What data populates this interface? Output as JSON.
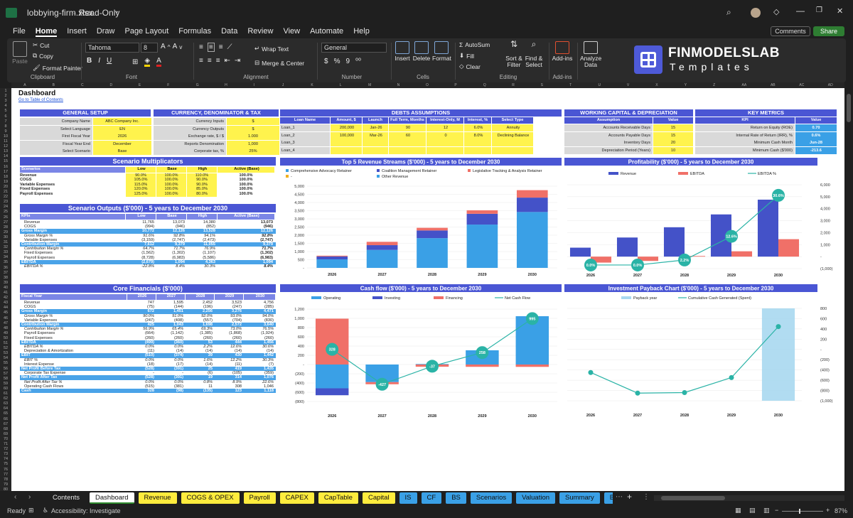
{
  "titlebar": {
    "filename": "lobbying-firm.xlsx",
    "mode": "Read-Only"
  },
  "menu": {
    "items": [
      "File",
      "Home",
      "Insert",
      "Draw",
      "Page Layout",
      "Formulas",
      "Data",
      "Review",
      "View",
      "Automate",
      "Help"
    ],
    "active": "Home",
    "comments": "Comments",
    "share": "Share"
  },
  "ribbon": {
    "clipboard": {
      "paste": "Paste",
      "cut": "Cut",
      "copy": "Copy",
      "painter": "Format Painter",
      "group": "Clipboard"
    },
    "font": {
      "name": "Tahoma",
      "size": "8",
      "group": "Font"
    },
    "alignment": {
      "wrap": "Wrap Text",
      "merge": "Merge & Center",
      "group": "Alignment"
    },
    "number": {
      "format": "General",
      "group": "Number"
    },
    "cells": {
      "insert": "Insert",
      "delete": "Delete",
      "format": "Format",
      "group": "Cells"
    },
    "editing": {
      "autosum": "AutoSum",
      "fill": "Fill",
      "clear": "Clear",
      "sort": "Sort &",
      "sort2": "Filter",
      "find": "Find &",
      "find2": "Select",
      "group": "Editing"
    },
    "addins": {
      "label": "Add-ins",
      "group": "Add-ins"
    },
    "analyze": {
      "label": "Analyze",
      "label2": "Data"
    },
    "brand": {
      "line1": "FINMODELSLAB",
      "line2": "Templates"
    }
  },
  "columns": [
    "A",
    "B",
    "C",
    "D",
    "E",
    "F",
    "G",
    "H",
    "I",
    "J",
    "K",
    "L",
    "M",
    "N",
    "O",
    "P",
    "Q",
    "R",
    "S",
    "T",
    "U",
    "V",
    "X",
    "Y",
    "Z",
    "AA",
    "AB",
    "AC",
    "AD"
  ],
  "sheet": {
    "title": "Dashboard",
    "toc": "Go to Table of Contents",
    "general": {
      "title": "GENERAL SETUP",
      "rows": [
        [
          "Company Name",
          "ABC Company Inc."
        ],
        [
          "Select Language",
          "EN"
        ],
        [
          "First Fiscal Year",
          "2026"
        ],
        [
          "Fiscal Year End",
          "December"
        ],
        [
          "Select Scenario",
          "Base"
        ]
      ]
    },
    "currency": {
      "title": "CURRENCY, DENOMINATOR & TAX",
      "rows": [
        [
          "Currency Inputs",
          "$"
        ],
        [
          "Currency Outputs",
          "$"
        ],
        [
          "Exchange rate, $ / $",
          "1.000"
        ],
        [
          "Reports Denomination",
          "1,000"
        ],
        [
          "Corporate tax, %",
          "25%"
        ]
      ]
    },
    "debts": {
      "title": "DEBTS ASSUMPTIONS",
      "headers": [
        "Loan Name",
        "Amount, $",
        "Launch",
        "Full Term, Months",
        "Interest-Only, M",
        "Interest, %",
        "Select Type"
      ],
      "rows": [
        [
          "Loan_1",
          "200,000",
          "Jan-26",
          "90",
          "12",
          "6.0%",
          "Annuity"
        ],
        [
          "Loan_2",
          "100,000",
          "Mar-26",
          "60",
          "0",
          "8.0%",
          "Declining Balance"
        ],
        [
          "Loan_3",
          "",
          "",
          "",
          "",
          "",
          ""
        ],
        [
          "Loan_4",
          "",
          "",
          "",
          "",
          "",
          ""
        ]
      ]
    },
    "wc": {
      "title": "WORKING CAPITAL & DEPRECIATION",
      "headers": [
        "Assumption",
        "Value"
      ],
      "rows": [
        [
          "Accounts Receivable Days",
          "15"
        ],
        [
          "Accounts Payable Days",
          "15"
        ],
        [
          "Inventory Days",
          "20"
        ],
        [
          "Depreciation Period (Years)",
          "10"
        ]
      ]
    },
    "kpi": {
      "title": "KEY METRICS",
      "headers": [
        "KPI",
        "Value"
      ],
      "rows": [
        [
          "Return on Equity (ROE)",
          "0.70"
        ],
        [
          "Internal Rate of Return (IRR), %",
          "0.6%"
        ],
        [
          "Minimum Cash Month",
          "Jun-28"
        ],
        [
          "Minimum Cash ($'000)",
          "-213.6"
        ]
      ]
    },
    "scen": {
      "title": "Scenario Multiplicators",
      "headers": [
        "Scenarios",
        "Low",
        "Base",
        "High",
        "Active (Base)"
      ],
      "rows": [
        [
          "Revenue",
          "90.0%",
          "100.0%",
          "110.0%",
          "100.0%"
        ],
        [
          "COGS",
          "105.0%",
          "100.0%",
          "90.0%",
          "100.0%"
        ],
        [
          "Variable Expenses",
          "115.0%",
          "100.0%",
          "90.0%",
          "100.0%"
        ],
        [
          "Fixed Expenses",
          "120.0%",
          "100.0%",
          "85.0%",
          "100.0%"
        ],
        [
          "Payroll Expenses",
          "125.0%",
          "100.0%",
          "80.0%",
          "100.0%"
        ]
      ]
    },
    "outputs": {
      "title": "Scenario Outputs ($'000) - 5 years to December 2030",
      "headers": [
        "KPIs",
        "Low",
        "Base",
        "High",
        "Active (Base)"
      ],
      "rows": [
        [
          "Revenue",
          "11,765",
          "13,073",
          "14,380",
          "13,073",
          "n"
        ],
        [
          "COGS",
          "(994)",
          "(946)",
          "(852)",
          "(946)",
          "n"
        ],
        [
          "Gross Margin",
          "10,772",
          "12,126",
          "13,528",
          "12,126",
          "h"
        ],
        [
          "Gross Margin %",
          "91.6%",
          "92.8%",
          "94.1%",
          "92.8%",
          "i"
        ],
        [
          "Variable Expenses",
          "(3,159)",
          "(2,747)",
          "(2,473)",
          "(2,747)",
          "n"
        ],
        [
          "Contribution Margin",
          "7,612",
          "9,379",
          "11,055",
          "9,379",
          "h"
        ],
        [
          "Contribution Margin %",
          "64.7%",
          "71.7%",
          "76.9%",
          "71.7%",
          "i"
        ],
        [
          "Fixed Expenses",
          "(1,562)",
          "(1,302)",
          "(1,107)",
          "(1,302)",
          "n"
        ],
        [
          "Payroll Expenses",
          "(8,728)",
          "(6,983)",
          "(5,586)",
          "(6,983)",
          "n"
        ],
        [
          "EBITDA",
          "(2,679)",
          "1,094",
          "4,363",
          "1,094",
          "h"
        ],
        [
          "EBITDA %",
          "-22.8%",
          "8.4%",
          "30.3%",
          "8.4%",
          "i"
        ]
      ]
    },
    "core": {
      "title": "Core Financials ($'000)",
      "headers": [
        "Fiscal Year",
        "2026",
        "2027",
        "2028",
        "2029",
        "2030"
      ],
      "rows": [
        [
          "Revenue",
          "747",
          "1,595",
          "2,452",
          "3,523",
          "4,756",
          "n"
        ],
        [
          "COGS",
          "(75)",
          "(144)",
          "(196)",
          "(247)",
          "(285)",
          "n"
        ],
        [
          "Gross Margin",
          "672",
          "1,451",
          "2,256",
          "3,276",
          "4,471",
          "h"
        ],
        [
          "Gross Margin %",
          "90.0%",
          "91.0%",
          "92.0%",
          "93.0%",
          "94.0%",
          "i"
        ],
        [
          "Variable Expenses",
          "(247)",
          "(408)",
          "(557)",
          "(704)",
          "(830)",
          "n"
        ],
        [
          "Contribution Margin",
          "425",
          "1,043",
          "1,698",
          "2,572",
          "3,640",
          "h"
        ],
        [
          "Contribution Margin %",
          "56.9%",
          "65.4%",
          "69.3%",
          "73.0%",
          "76.5%",
          "i"
        ],
        [
          "Payroll Expenses",
          "(664)",
          "(1,142)",
          "(1,385)",
          "(1,868)",
          "(1,924)",
          "n"
        ],
        [
          "Fixed Expenses",
          "(260)",
          "(260)",
          "(260)",
          "(260)",
          "(260)",
          "n"
        ],
        [
          "EBITDA",
          "(499)",
          "(360)",
          "53",
          "444",
          "1,456",
          "h"
        ],
        [
          "EBITDA %",
          "0.0%",
          "0.0%",
          "2.2%",
          "12.6%",
          "30.6%",
          "i"
        ],
        [
          "Depreciation & Amortization",
          "(11)",
          "(14)",
          "(14)",
          "(14)",
          "(14)",
          "n"
        ],
        [
          "EBIT",
          "(510)",
          "(374)",
          "39",
          "430",
          "1,442",
          "h"
        ],
        [
          "EBIT %",
          "0.0%",
          "0.0%",
          "1.6%",
          "12.2%",
          "30.3%",
          "i"
        ],
        [
          "Interest Expense",
          "(18)",
          "(17)",
          "(14)",
          "(11)",
          "(7)",
          "n"
        ],
        [
          "Net Profit Before Tax",
          "(528)",
          "(391)",
          "25",
          "419",
          "1,435",
          "h"
        ],
        [
          "Corporate Tax Expense",
          "-",
          "-",
          "(6)",
          "(105)",
          "(359)",
          "n"
        ],
        [
          "Net Profit After Tax",
          "(528)",
          "(391)",
          "19",
          "314",
          "1,076",
          "h"
        ],
        [
          "Net Profit After Tax %",
          "0.0%",
          "0.0%",
          "0.8%",
          "8.9%",
          "22.6%",
          "i"
        ],
        [
          "Operating Cash Flows",
          "(515)",
          "(381)",
          "11",
          "308",
          "1,046",
          "n"
        ],
        [
          "Cash",
          "328",
          "(98)",
          "(135)",
          "123",
          "1,118",
          "h"
        ]
      ]
    }
  },
  "charts": [
    {
      "type": "bar",
      "title": "Top 5 Revenue Streams ($'000) - 5 years to December 2030",
      "categories": [
        "2026",
        "2027",
        "2028",
        "2029",
        "2030"
      ],
      "series": [
        {
          "name": "Comprehensive Advocacy Retainer",
          "color": "#3aa0e6",
          "values": [
            520,
            1100,
            1820,
            2650,
            3420
          ]
        },
        {
          "name": "Coalition Management Retainer",
          "color": "#4452c8",
          "values": [
            180,
            290,
            470,
            660,
            880
          ]
        },
        {
          "name": "Legislative Tracking & Analysis Retainer",
          "color": "#f07068",
          "values": [
            47,
            205,
            162,
            213,
            456
          ]
        },
        {
          "name": "-",
          "color": "#f0b020",
          "values": [
            0,
            0,
            0,
            0,
            0
          ]
        },
        {
          "name": "Other Revenue",
          "color": "#3aa0e6",
          "values": [
            0,
            0,
            0,
            0,
            0
          ]
        }
      ],
      "yticks": [
        "5,000",
        "4,500",
        "4,000",
        "3,500",
        "3,000",
        "2,500",
        "2,000",
        "1,500",
        "1,000",
        "500",
        "-"
      ],
      "ylim": [
        0,
        5000
      ]
    },
    {
      "type": "bar",
      "title": "Profitability ($'000) - 5 years to December 2030",
      "categories": [
        "2026",
        "2027",
        "2028",
        "2029",
        "2030"
      ],
      "series": [
        {
          "name": "Revenue",
          "color": "#4452c8",
          "values": [
            747,
            1595,
            2452,
            3523,
            4756
          ]
        },
        {
          "name": "EBITDA",
          "color": "#f07068",
          "values": [
            -499,
            -360,
            53,
            444,
            1456
          ]
        },
        {
          "name": "EBITDA %",
          "color": "#2ab3a6",
          "values": [
            0.0,
            0.0,
            2.2,
            12.6,
            30.6
          ]
        }
      ],
      "yticks": [
        "6,000",
        "5,000",
        "4,000",
        "3,000",
        "2,000",
        "1,000",
        "-",
        "(1,000)"
      ],
      "ylim": [
        -1000,
        6000
      ],
      "pct_labels": [
        "0.0%",
        "0.0%",
        "2.2%",
        "12.6%",
        "30.6%"
      ]
    },
    {
      "type": "bar",
      "title": "Cash flow ($'000) - 5 years to December 2030",
      "categories": [
        "2026",
        "2027",
        "2028",
        "2029",
        "2030"
      ],
      "series": [
        {
          "name": "Operating",
          "color": "#3aa0e6",
          "values": [
            -515,
            -381,
            11,
            308,
            1046
          ]
        },
        {
          "name": "Investing",
          "color": "#4452c8",
          "values": [
            -150,
            0,
            0,
            0,
            0
          ]
        },
        {
          "name": "Financing",
          "color": "#f07068",
          "values": [
            993,
            -46,
            -48,
            -50,
            -51
          ]
        },
        {
          "name": "Net Cash Flow",
          "color": "#2ab3a6",
          "values": [
            328,
            -427,
            -37,
            258,
            995
          ]
        }
      ],
      "yticks": [
        "1,200",
        "1,000",
        "800",
        "600",
        "400",
        "200",
        "-",
        "(200)",
        "(400)",
        "(600)",
        "(800)"
      ],
      "ylim": [
        -800,
        1200
      ],
      "point_labels": [
        "328",
        "-427",
        "-37",
        "258",
        "995"
      ]
    },
    {
      "type": "bar",
      "title": "Investment Payback Chart ($'000) - 5 years to December 2030",
      "categories": [
        "2026",
        "2027",
        "2028",
        "2029",
        "2030"
      ],
      "series": [
        {
          "name": "Payback year",
          "color": "#a8d8f0",
          "values": [
            0,
            0,
            0,
            0,
            1
          ]
        },
        {
          "name": "Cumulative Cash Generated (Spent)",
          "color": "#2ab3a6",
          "values": [
            -515,
            -896,
            -885,
            -577,
            469
          ]
        }
      ],
      "yticks": [
        "800",
        "600",
        "400",
        "200",
        "-",
        "(200)",
        "(400)",
        "(600)",
        "(800)",
        "(1,000)"
      ],
      "ylim": [
        -1000,
        800
      ]
    }
  ],
  "tabs": {
    "items": [
      [
        "Contents",
        "plain"
      ],
      [
        "Dashboard",
        "active"
      ],
      [
        "Revenue",
        "y"
      ],
      [
        "COGS & OPEX",
        "y"
      ],
      [
        "Payroll",
        "y"
      ],
      [
        "CAPEX",
        "y"
      ],
      [
        "CapTable",
        "y"
      ],
      [
        "Capital",
        "y"
      ],
      [
        "IS",
        "bl"
      ],
      [
        "CF",
        "bl"
      ],
      [
        "BS",
        "bl"
      ],
      [
        "Scenarios",
        "bl"
      ],
      [
        "Valuation",
        "bl"
      ],
      [
        "Summary",
        "bl"
      ],
      [
        "BE",
        "bl"
      ],
      [
        "ROIC",
        "bl"
      ],
      [
        "Charts",
        "bl"
      ],
      [
        "KPIs",
        "bl"
      ],
      [
        "S",
        "bl"
      ]
    ]
  },
  "status": {
    "ready": "Ready",
    "accessibility": "Accessibility: Investigate",
    "zoom": "87%"
  }
}
